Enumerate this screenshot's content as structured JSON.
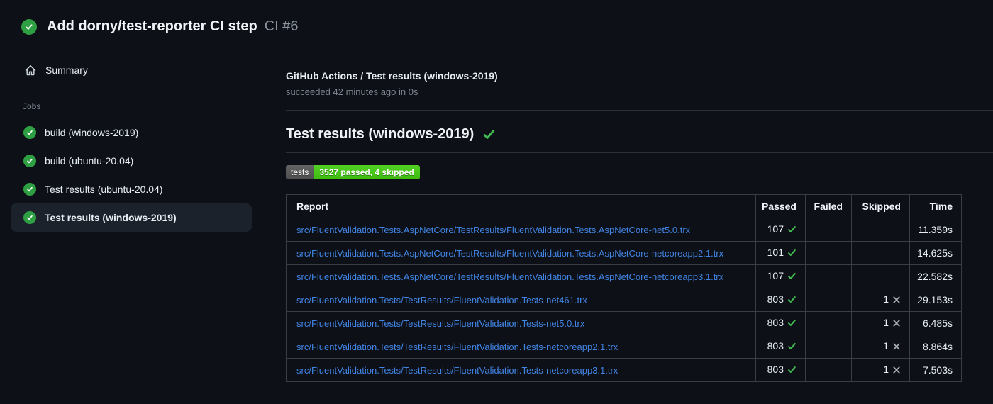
{
  "colors": {
    "success_green": "#2ea043",
    "check_green": "#3fb950",
    "link_blue": "#4184e4",
    "badge_label_bg": "#555555",
    "badge_value_bg": "#44cc11",
    "x_gray": "#aab2bb"
  },
  "run": {
    "title": "Add dorny/test-reporter CI step",
    "number": "CI #6"
  },
  "sidebar": {
    "summary_label": "Summary",
    "jobs_label": "Jobs",
    "jobs": [
      {
        "label": "build (windows-2019)",
        "active": false
      },
      {
        "label": "build (ubuntu-20.04)",
        "active": false
      },
      {
        "label": "Test results (ubuntu-20.04)",
        "active": false
      },
      {
        "label": "Test results (windows-2019)",
        "active": true
      }
    ]
  },
  "main": {
    "check_title": "GitHub Actions / Test results (windows-2019)",
    "check_status": "succeeded 42 minutes ago in 0s",
    "heading": "Test results (windows-2019)",
    "badge": {
      "label": "tests",
      "value": "3527 passed, 4 skipped"
    },
    "table": {
      "headers": [
        "Report",
        "Passed",
        "Failed",
        "Skipped",
        "Time"
      ],
      "rows": [
        {
          "report": "src/FluentValidation.Tests.AspNetCore/TestResults/FluentValidation.Tests.AspNetCore-net5.0.trx",
          "passed": "107",
          "failed": "",
          "skipped": "",
          "time": "11.359s"
        },
        {
          "report": "src/FluentValidation.Tests.AspNetCore/TestResults/FluentValidation.Tests.AspNetCore-netcoreapp2.1.trx",
          "passed": "101",
          "failed": "",
          "skipped": "",
          "time": "14.625s"
        },
        {
          "report": "src/FluentValidation.Tests.AspNetCore/TestResults/FluentValidation.Tests.AspNetCore-netcoreapp3.1.trx",
          "passed": "107",
          "failed": "",
          "skipped": "",
          "time": "22.582s"
        },
        {
          "report": "src/FluentValidation.Tests/TestResults/FluentValidation.Tests-net461.trx",
          "passed": "803",
          "failed": "",
          "skipped": "1",
          "time": "29.153s"
        },
        {
          "report": "src/FluentValidation.Tests/TestResults/FluentValidation.Tests-net5.0.trx",
          "passed": "803",
          "failed": "",
          "skipped": "1",
          "time": "6.485s"
        },
        {
          "report": "src/FluentValidation.Tests/TestResults/FluentValidation.Tests-netcoreapp2.1.trx",
          "passed": "803",
          "failed": "",
          "skipped": "1",
          "time": "8.864s"
        },
        {
          "report": "src/FluentValidation.Tests/TestResults/FluentValidation.Tests-netcoreapp3.1.trx",
          "passed": "803",
          "failed": "",
          "skipped": "1",
          "time": "7.503s"
        }
      ]
    }
  }
}
